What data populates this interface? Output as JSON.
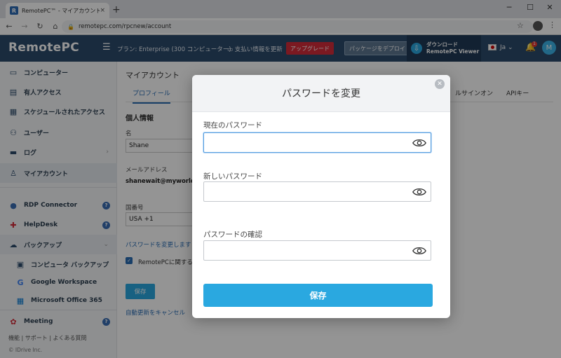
{
  "browser": {
    "tab_title": "RemotePC™ - マイアカウント情報",
    "tab_close": "×",
    "new_tab": "+",
    "url": "remotepc.com/rpcnew/account",
    "win_min": "─",
    "win_max": "☐",
    "win_close": "✕"
  },
  "topnav": {
    "logo": "RemotePC",
    "plan": "プラン: Enterprise (300 コンピューター)",
    "payment_update": "支払い情報を更新",
    "upgrade": "アップグレード",
    "deploy": "パッケージをデプロイ",
    "download_line1": "ダウンロード",
    "download_line2": "RemotePC Viewer",
    "lang": "Ja",
    "bell_count": "1",
    "avatar_letter": "M"
  },
  "sidebar": {
    "items": [
      {
        "label": "コンピューター"
      },
      {
        "label": "有人アクセス"
      },
      {
        "label": "スケジュールされたアクセス"
      },
      {
        "label": "ユーザー"
      },
      {
        "label": "ログ"
      },
      {
        "label": "マイアカウント"
      },
      {
        "label": "RDP Connector"
      },
      {
        "label": "HelpDesk"
      },
      {
        "label": "バックアップ"
      },
      {
        "label": "コンピュータ バックアップ"
      },
      {
        "label": "Google Workspace"
      },
      {
        "label": "Microsoft Office 365"
      },
      {
        "label": "Meeting"
      }
    ],
    "help_glyph": "?",
    "footer_links": "機能 | サポート | よくある質問",
    "copyright": "© IDrive Inc."
  },
  "main": {
    "title": "マイアカウント",
    "tabs": [
      {
        "label": "プロフィール"
      },
      {
        "label": "ルサインオン"
      },
      {
        "label": "APIキー"
      }
    ],
    "section": "個人情報",
    "name_label": "名",
    "name_value": "Shane",
    "email_label": "メールアドレス",
    "email_value": "shanewait@myworld.c",
    "country_label": "国番号",
    "country_value": "USA +1",
    "change_password_link": "パスワードを変更します",
    "checkbox_label": "RemotePCに関する",
    "save_button": "保存",
    "autorenew_link": "自動更新をキャンセル"
  },
  "modal": {
    "title": "パスワードを変更",
    "close": "✕",
    "current_password_label": "現在のパスワード",
    "new_password_label": "新しいパスワード",
    "confirm_password_label": "パスワードの確認",
    "save": "保存"
  }
}
